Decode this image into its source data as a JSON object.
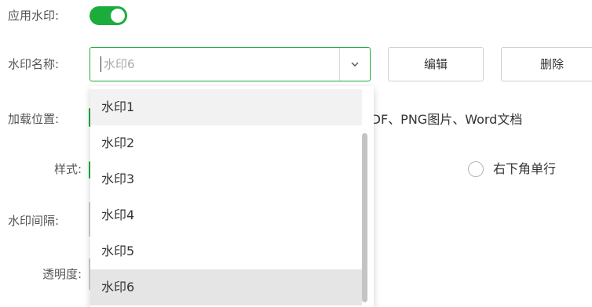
{
  "form": {
    "apply_label": "应用水印:",
    "apply_enabled": true,
    "name_label": "水印名称:",
    "name_select": {
      "value": "水印6"
    },
    "edit_button": "编辑",
    "delete_button": "删除",
    "position_label": "加载位置:",
    "position_text": "PDF、PNG图片、Word文档",
    "style_label": "样式:",
    "style_option_right": "右下角单行",
    "interval_label": "水印间隔:",
    "opacity_label": "透明度:"
  },
  "dropdown": {
    "options": [
      "水印1",
      "水印2",
      "水印3",
      "水印4",
      "水印5",
      "水印6"
    ],
    "hovered_index": 0,
    "selected_index": 5
  },
  "colors": {
    "accent": "#1aad3c",
    "hover": "#f2f2f2",
    "selected": "#e5e5e5"
  },
  "icons": {
    "select_chevron": "chevron-down-icon",
    "radio": "radio-unchecked-icon"
  }
}
